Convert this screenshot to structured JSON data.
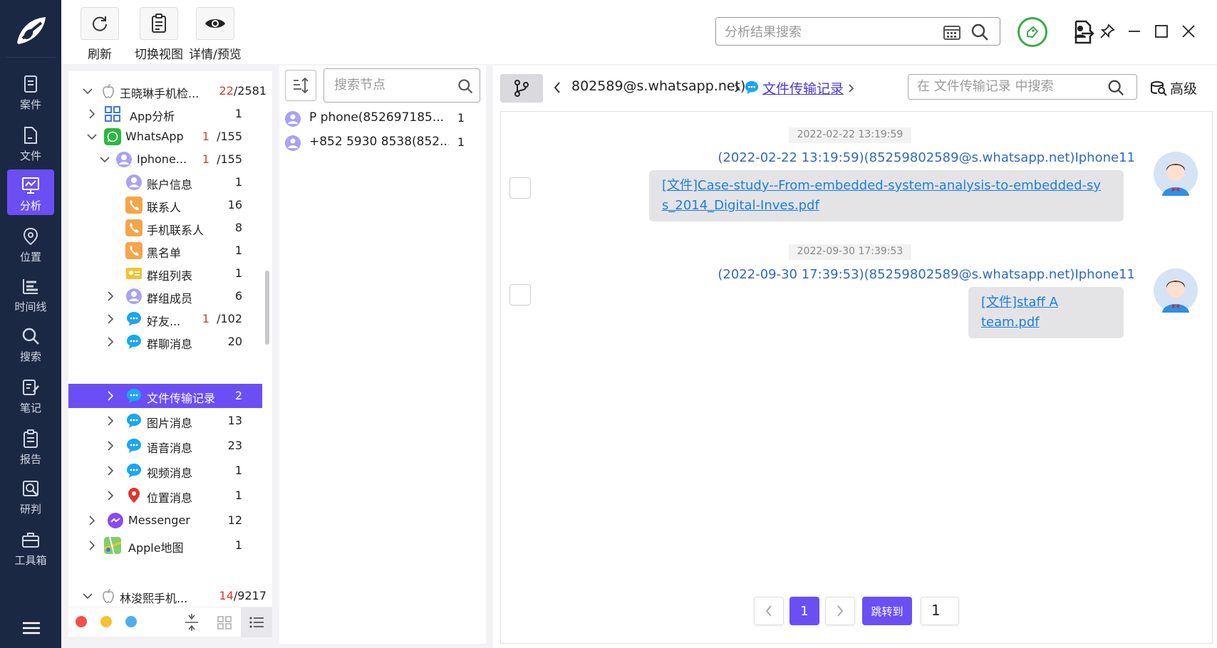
{
  "nav": {
    "items": [
      {
        "label": "案件",
        "icon": "case-icon"
      },
      {
        "label": "文件",
        "icon": "file-icon"
      },
      {
        "label": "分析",
        "icon": "analysis-icon"
      },
      {
        "label": "位置",
        "icon": "location-icon"
      },
      {
        "label": "时间线",
        "icon": "timeline-icon"
      },
      {
        "label": "搜索",
        "icon": "search-icon"
      },
      {
        "label": "笔记",
        "icon": "notes-icon"
      },
      {
        "label": "报告",
        "icon": "report-icon"
      },
      {
        "label": "研判",
        "icon": "judge-icon"
      },
      {
        "label": "工具箱",
        "icon": "toolbox-icon"
      }
    ],
    "active": "分析"
  },
  "toolbar": {
    "refresh_label": "刷新",
    "switch_view_label": "切换视图",
    "details_label": "详情/预览",
    "search_placeholder": "分析结果搜索"
  },
  "tree": {
    "rows": [
      {
        "label": "王晓琳手机检...",
        "count_red": "22",
        "count": "/2581"
      },
      {
        "label": "App分析",
        "count": "1"
      },
      {
        "label": "WhatsApp",
        "count_red": "1",
        "count": "/155"
      },
      {
        "label": "Iphone...",
        "count_red": "1",
        "count": "/155"
      },
      {
        "label": "账户信息",
        "count": "1"
      },
      {
        "label": "联系人",
        "count": "16"
      },
      {
        "label": "手机联系人",
        "count": "8"
      },
      {
        "label": "黑名单",
        "count": "1"
      },
      {
        "label": "群组列表",
        "count": "1"
      },
      {
        "label": "群组成员",
        "count": "6"
      },
      {
        "label": "好友...",
        "count_red": "1",
        "count": "/102"
      },
      {
        "label": "群聊消息",
        "count": "20"
      },
      {
        "label": "文件传输记录",
        "count": "2"
      },
      {
        "label": "图片消息",
        "count": "13"
      },
      {
        "label": "语音消息",
        "count": "23"
      },
      {
        "label": "视频消息",
        "count": "1"
      },
      {
        "label": "位置消息",
        "count": "1"
      },
      {
        "label": "Messenger",
        "count": "12"
      },
      {
        "label": "Apple地图",
        "count": "1"
      },
      {
        "label": "林浚熙手机...",
        "count_red": "14",
        "count": "/9217"
      }
    ],
    "selected": "文件传输记录",
    "dot_colors": [
      "#f0504a",
      "#f5c232",
      "#4aaef0"
    ]
  },
  "nodes": {
    "search_placeholder": "搜索节点",
    "items": [
      {
        "label": "P phone(852697185...",
        "count": "1"
      },
      {
        "label": "+852 5930 8538(852...",
        "count": "1"
      }
    ]
  },
  "content": {
    "breadcrumb_contact": "802589@s.whatsapp.net)",
    "breadcrumb_current": "文件传输记录",
    "search_placeholder": "在 文件传输记录 中搜索",
    "advanced_label": "高级",
    "messages": [
      {
        "timestamp": "2022-02-22 13:19:59",
        "sender": "(2022-02-22 13:19:59)(85259802589@s.whatsapp.net)Iphone11",
        "text": "[文件]Case-study--From-embedded-system-analysis-to-embedded-system_2014_Digital-Inves.pdf",
        "text_line1": "[文件]Case-study--From-embedded-system-analysis-to-embedded-sy",
        "text_line2": "s_2014_Digital-Inves.pdf"
      },
      {
        "timestamp": "2022-09-30 17:39:53",
        "sender": "(2022-09-30 17:39:53)(85259802589@s.whatsapp.net)Iphone11",
        "text": "[文件]staff A team.pdf"
      }
    ],
    "pager": {
      "current_page": "1",
      "jump_label": "跳转到",
      "jump_value": "1"
    }
  },
  "colors": {
    "accent": "#6c4ef5",
    "nav_bg": "#1b2844",
    "link": "#1a7ee6",
    "sender": "#2f69c4",
    "green": "#3aaa4a",
    "red_count": "#e0362c"
  }
}
